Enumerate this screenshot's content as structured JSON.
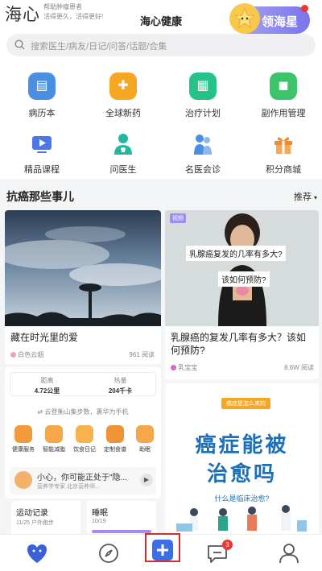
{
  "header": {
    "logo": "海心",
    "slogan_line1": "帮助肿瘤患者",
    "slogan_line2": "活得更久，活得更好!",
    "title": "海心健康",
    "star_button": "领海星"
  },
  "search": {
    "placeholder": "搜索医生/病友/日记/问答/话题/合集"
  },
  "grid": [
    {
      "label": "病历本",
      "icon": "medical-record-icon",
      "color": "#4a90e2"
    },
    {
      "label": "全球新药",
      "icon": "new-drug-icon",
      "color": "#f5a623"
    },
    {
      "label": "治疗计划",
      "icon": "treatment-plan-icon",
      "color": "#27c28a"
    },
    {
      "label": "副作用管理",
      "icon": "side-effect-icon",
      "color": "#3cc46b"
    },
    {
      "label": "精品课程",
      "icon": "course-icon",
      "color": "#4a78e8"
    },
    {
      "label": "问医生",
      "icon": "doctor-icon",
      "color": "#22b8a0"
    },
    {
      "label": "名医会诊",
      "icon": "consultation-icon",
      "color": "#4a90e2"
    },
    {
      "label": "积分商城",
      "icon": "gift-icon",
      "color": "#f08a2a"
    }
  ],
  "section": {
    "title": "抗癌那些事儿",
    "sort_label": "推荐"
  },
  "cards": {
    "card1": {
      "title": "藏在时光里的爱",
      "author": "白色云烟",
      "reads": "961 阅读"
    },
    "card2": {
      "tag": "视频",
      "overlay_q1": "乳腺癌复发的几率有多大?",
      "overlay_q2": "该如何预防?",
      "title": "乳腺癌的复发几率有多大？该如何预防?",
      "author": "乳宝宝",
      "reads": "8.6W 阅读"
    },
    "stats": {
      "distance_label": "距离",
      "distance_value": "4.72公里",
      "calorie_label": "热量",
      "calorie_value": "204千卡",
      "sync_text": "云登衡山集步数，裹华为手机",
      "mini_items": [
        "健康服务",
        "智能减脂",
        "饮食日记",
        "定制食谱",
        "助眠"
      ],
      "warning_title": "小心，你可能正处于\"隐...",
      "warning_sub": "营养学专家 北京营养师..."
    },
    "poster": {
      "label": "癌症是怎么来的",
      "title_line1": "癌症能被",
      "title_line2": "治愈吗",
      "subtitle": "什么是临床治愈?"
    },
    "sport": {
      "title": "运动记录",
      "sub": "11/25 户外跑步"
    },
    "sleep": {
      "title": "睡眠",
      "sub": "10/19"
    }
  },
  "tabbar": {
    "items": [
      "home-icon",
      "discover-icon",
      "add-icon",
      "message-icon",
      "profile-icon"
    ],
    "message_badge": "3"
  }
}
